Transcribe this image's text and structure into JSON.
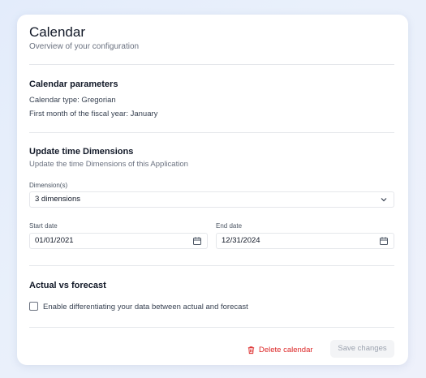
{
  "header": {
    "title": "Calendar",
    "subtitle": "Overview of your configuration"
  },
  "calendar_parameters": {
    "heading": "Calendar parameters",
    "type_line": "Calendar type: Gregorian",
    "fiscal_line": "First month of the fiscal year: January"
  },
  "time_dimensions": {
    "heading": "Update time Dimensions",
    "description": "Update the time Dimensions of this Application",
    "dimension_label": "Dimension(s)",
    "dimension_value": "3 dimensions",
    "start_label": "Start date",
    "start_value": "01/01/2021",
    "end_label": "End date",
    "end_value": "12/31/2024"
  },
  "forecast": {
    "heading": "Actual vs forecast",
    "checkbox_label": "Enable differentiating your data between actual and forecast",
    "checked": false
  },
  "actions": {
    "delete_label": "Delete calendar",
    "save_label": "Save changes"
  },
  "colors": {
    "danger": "#dc2626",
    "disabled_text": "#9ca3af",
    "disabled_bg": "#f3f4f6"
  },
  "icons": {
    "select_arrow": "chevron-down-icon",
    "date": "calendar-icon",
    "delete": "trash-icon"
  }
}
